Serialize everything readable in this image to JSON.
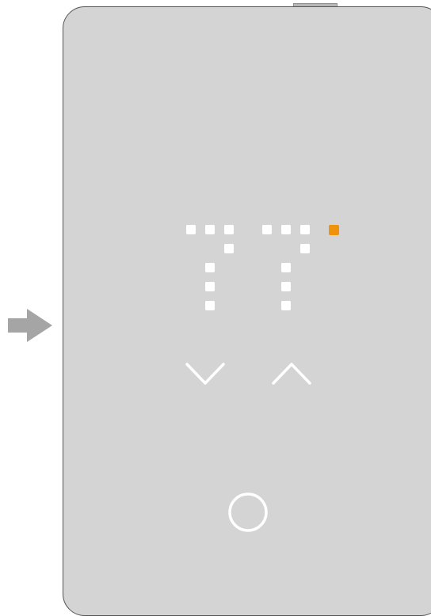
{
  "device": {
    "name": "thermostat",
    "colors": {
      "housing": "#d4d4d4",
      "outline": "#555555",
      "segment": "#ffffff",
      "indicator": "#f0930c",
      "pointer": "#a5a5a5"
    }
  },
  "display": {
    "reading": "77",
    "indicator_on": true
  },
  "controls": {
    "down_icon": "chevron-down-icon",
    "up_icon": "chevron-up-icon",
    "power_icon": "circle-icon"
  },
  "pointer_icon": "arrow-right-icon"
}
